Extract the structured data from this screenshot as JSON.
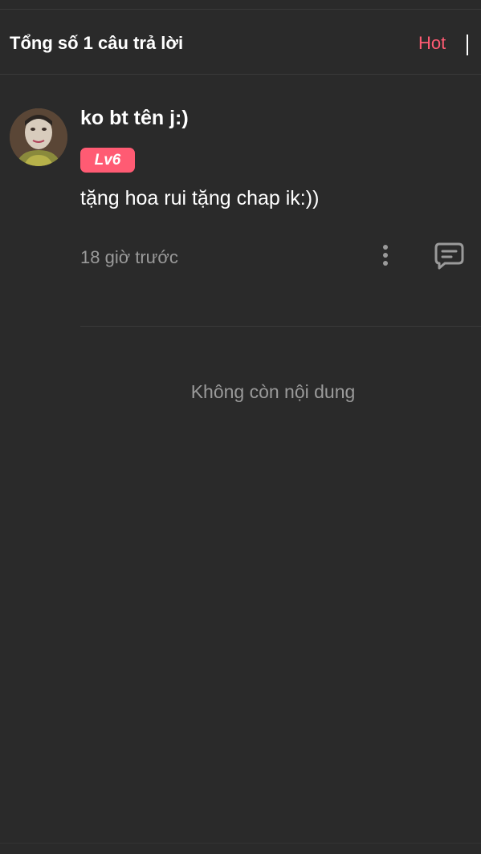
{
  "header": {
    "title": "Tổng số 1 câu trả lời",
    "sort_label": "Hot"
  },
  "comment": {
    "username": "ko bt tên j:)",
    "level": "Lv6",
    "text": "tặng hoa rui tặng chap ik:))",
    "time": "18 giờ trước"
  },
  "footer": {
    "end_text": "Không còn nội dung"
  },
  "colors": {
    "background": "#2a2a2a",
    "accent": "#ff5b73",
    "muted_text": "#9a9a9a"
  },
  "icons": {
    "more": "more-vertical-icon",
    "reply": "comment-bubble-icon"
  }
}
